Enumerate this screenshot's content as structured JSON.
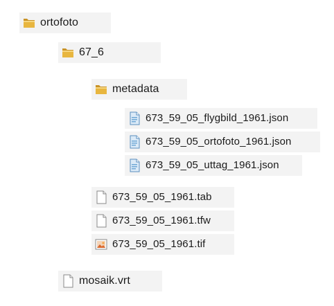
{
  "tree": {
    "items": [
      {
        "label": "ortofoto",
        "icon": "folder-icon"
      },
      {
        "label": "67_6",
        "icon": "folder-icon"
      },
      {
        "label": "metadata",
        "icon": "folder-icon"
      },
      {
        "label": "673_59_05_flygbild_1961.json",
        "icon": "json-file-icon"
      },
      {
        "label": "673_59_05_ortofoto_1961.json",
        "icon": "json-file-icon"
      },
      {
        "label": "673_59_05_uttag_1961.json",
        "icon": "json-file-icon"
      },
      {
        "label": "673_59_05_1961.tab",
        "icon": "blank-file-icon"
      },
      {
        "label": "673_59_05_1961.tfw",
        "icon": "blank-file-icon"
      },
      {
        "label": "673_59_05_1961.tif",
        "icon": "image-file-icon"
      },
      {
        "label": "mosaik.vrt",
        "icon": "blank-file-icon"
      }
    ]
  },
  "colors": {
    "folder": "#e8b63f",
    "folder_dark": "#c99327",
    "item_background": "#f3f3f3",
    "json_icon": "#6fa8d6",
    "image_icon": "#d9682e"
  }
}
